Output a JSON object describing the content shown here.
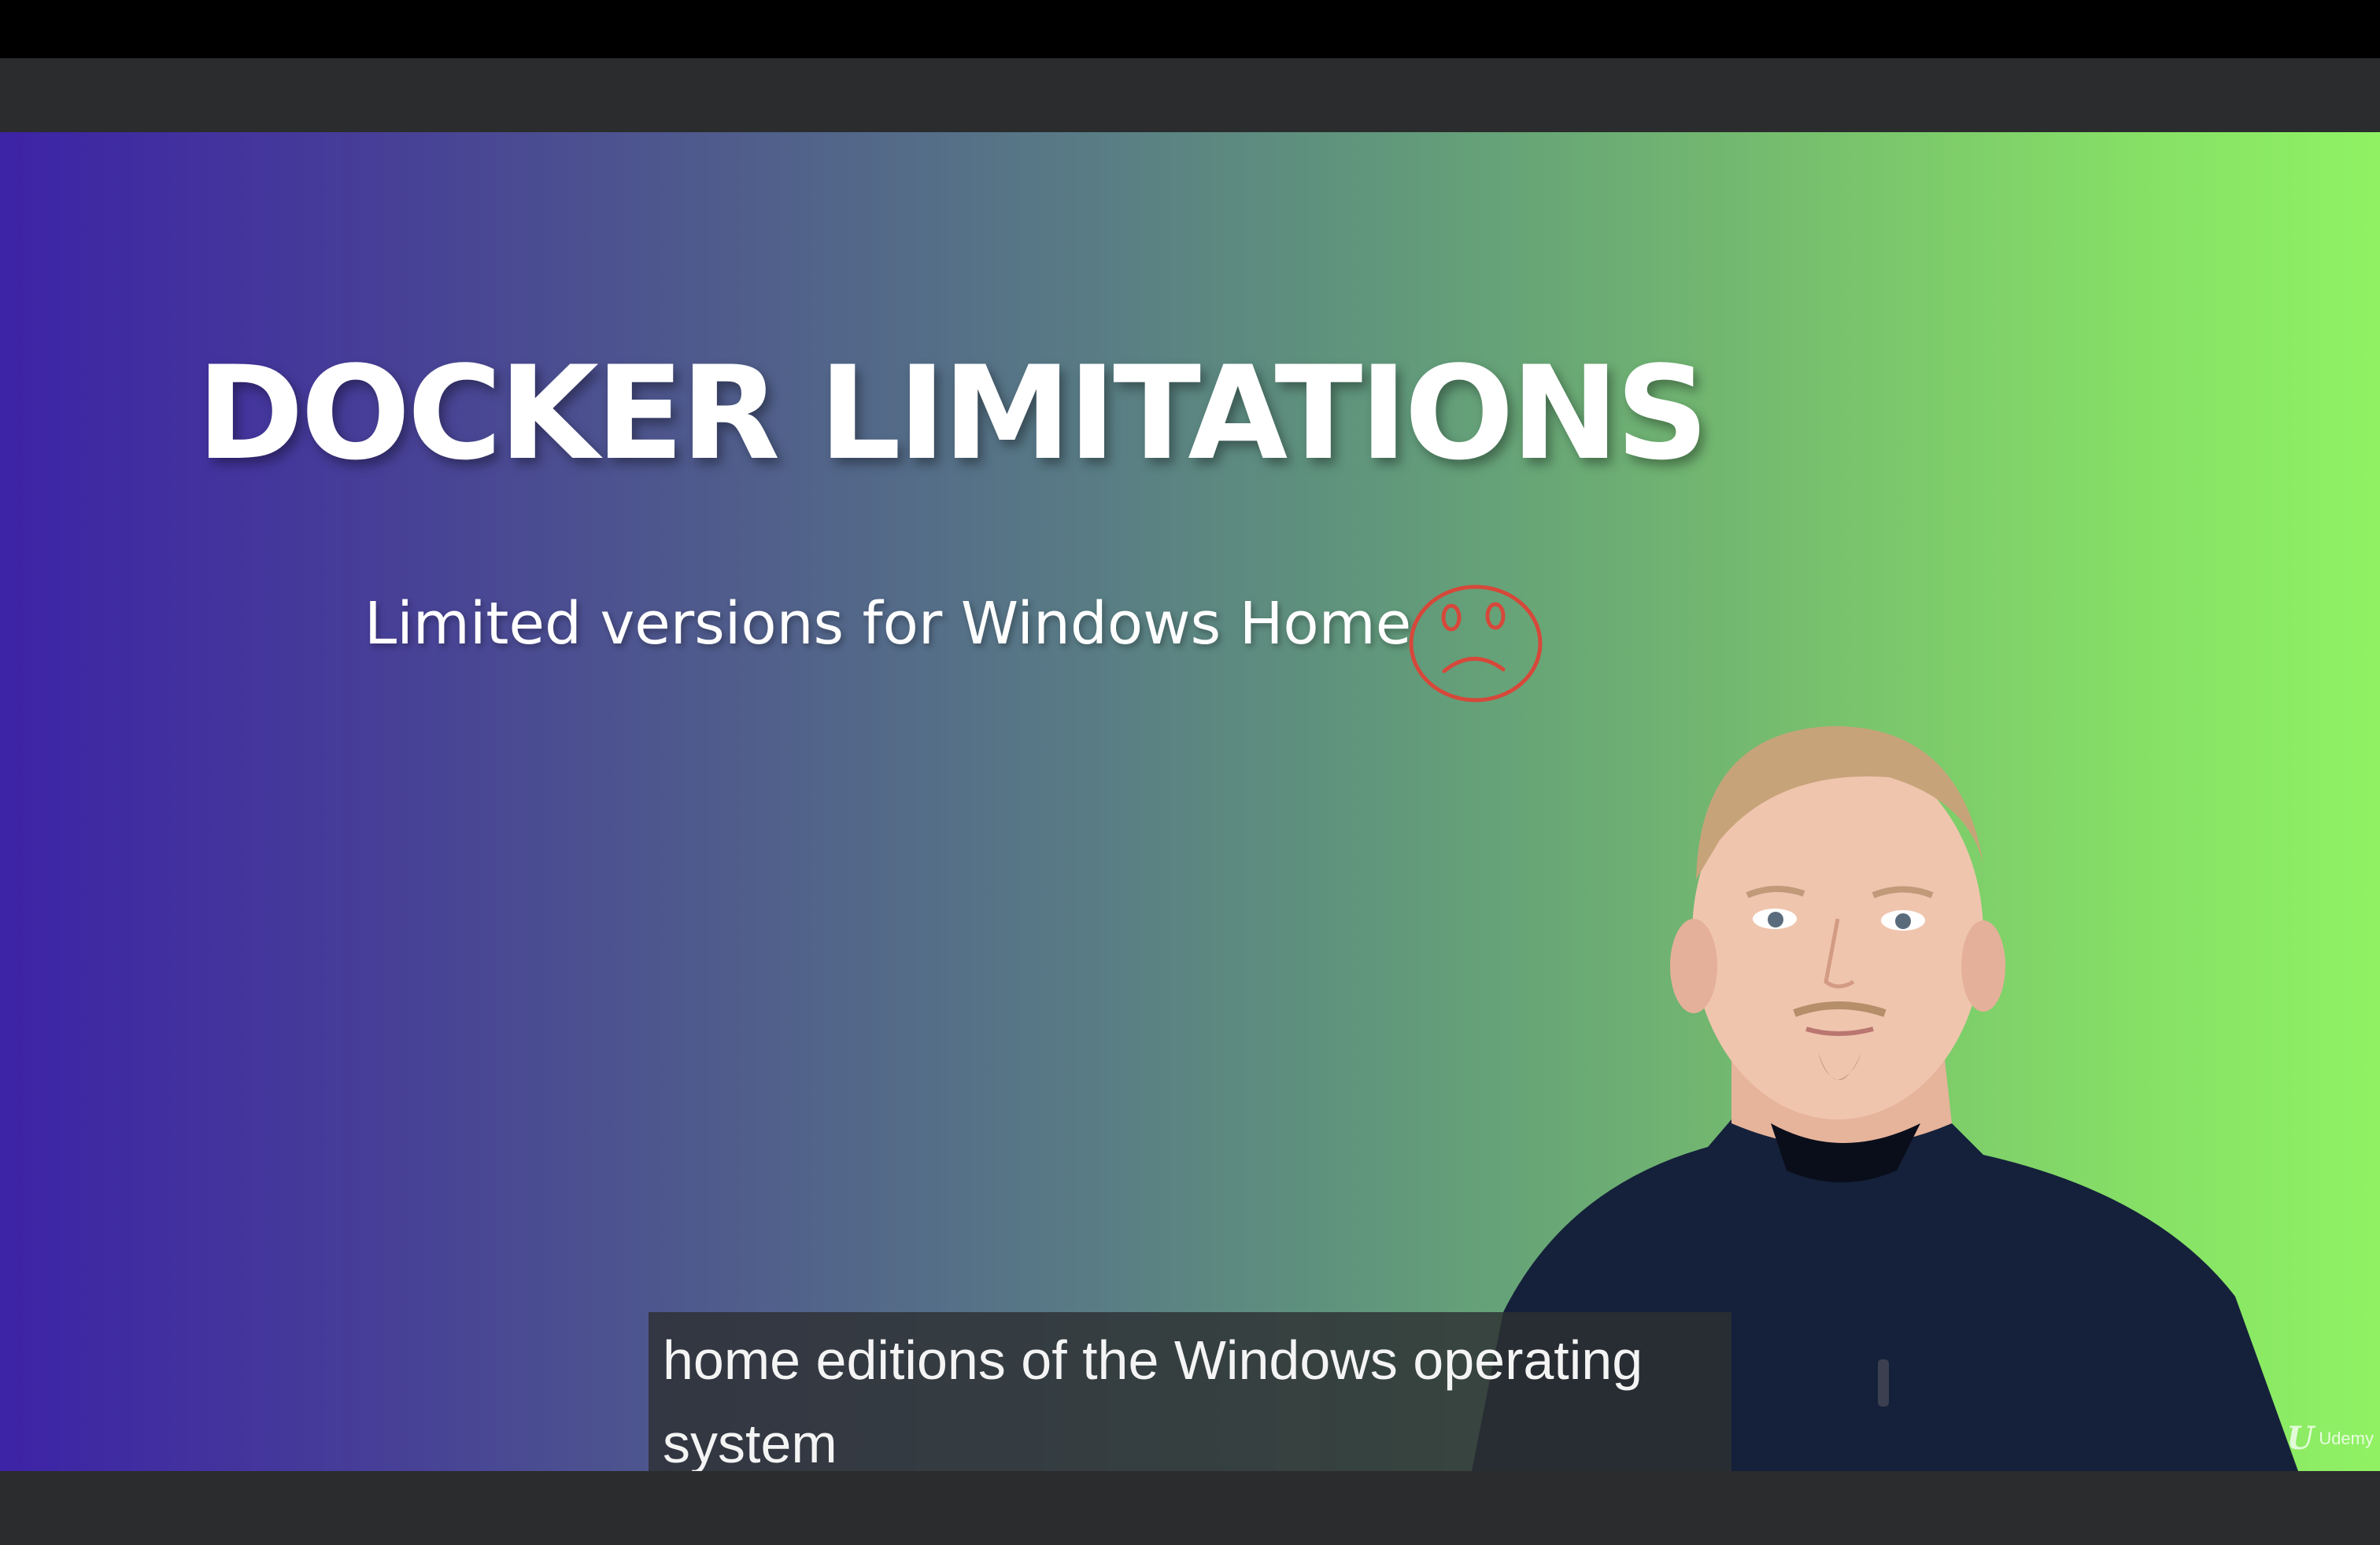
{
  "slide": {
    "title": "DOCKER LIMITATIONS",
    "subtitle": "Limited versions for Windows Home",
    "sad_face": "sad-face-icon"
  },
  "captions": {
    "line1": "home editions of the Windows operating",
    "line2": "system"
  },
  "watermark": {
    "logo": "U",
    "text": "Udemy"
  },
  "colors": {
    "gradient_start": "#3d23a6",
    "gradient_end": "#90f263",
    "sad_face_stroke": "#d6483a",
    "player_chrome": "#2b2c2e"
  }
}
